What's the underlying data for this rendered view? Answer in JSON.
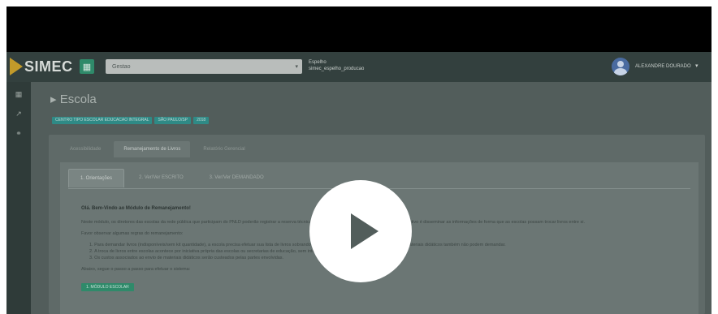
{
  "topbar": {
    "logo_text": "SIMEC",
    "menu_icon": "grid-icon",
    "system_select_value": "Gestao",
    "db_line1": "Espelho",
    "db_line2": "simec_espelho_producao",
    "user_name": "ALEXANDRE DOURADO"
  },
  "sidebar": {
    "icons": [
      "grid-icon",
      "chart-line-icon",
      "share-icon"
    ]
  },
  "page": {
    "title": "Escola",
    "badges": [
      "CENTRO TIPO ESCOLAR EDUCACAO INTEGRAL",
      "SÃO PAULO/SP",
      "2018"
    ]
  },
  "tabs_top": [
    "Acessibilidade",
    "Remanejamento de Livros",
    "Relatório Gerencial"
  ],
  "tabs_inner": [
    "1. Orientações",
    "2. Ver/Ver ESCRITO",
    "3. Ver/Ver DEMANDADO"
  ],
  "article": {
    "title": "Olá. Bem-Vindo ao Módulo de Remanejamento!",
    "p1": "Neste módulo, os diretores das escolas da rede pública que participam do PNLD poderão registrar a reserva técnica e o remanejamento de livros do programa. O objetivo é disseminar as informações de forma que as escolas possam trocar livros entre si.",
    "p2": "Favor observar algumas regras do remanejamento:",
    "list": [
      "Para demandar livros (indisponíveis/sem kit quantidade), a escola precisa efetuar sua lista de livros sobrando e de livros que deseja; as escolas que ofertam materiais didáticos também não podem demandar.",
      "A troca de livros entre escolas acontece por iniciativa própria das escolas ou secretarias de educação, sem interferência do FNDE.",
      "Os custos associados ao envio de materiais didáticos serão custeados pelas partes envolvidas."
    ],
    "p3": "Abaixo, segue o passo a passo para efetuar o sistema:",
    "button_label": "1. MÓDULO ESCOLAR"
  },
  "video": {
    "play_icon": "play-icon"
  }
}
